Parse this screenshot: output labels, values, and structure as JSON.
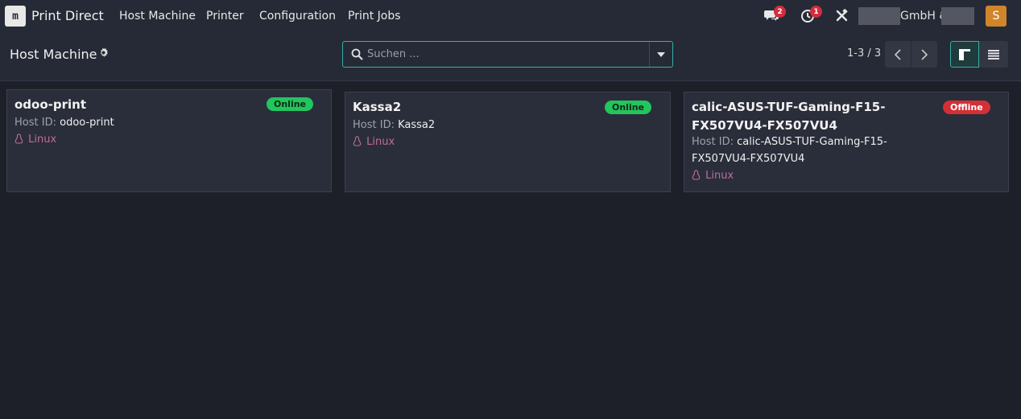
{
  "navbar": {
    "app_icon_text": "m",
    "app_name": "Print Direct",
    "menu": [
      "Host Machine",
      "Printer",
      "Configuration",
      "Print Jobs"
    ],
    "messages_count": "2",
    "activities_count": "1",
    "company_visible": "GmbH &",
    "avatar_letter": "S"
  },
  "control_panel": {
    "breadcrumb": "Host Machine",
    "search_placeholder": "Suchen ...",
    "pager": "1-3 / 3"
  },
  "cards": [
    {
      "name": "odoo-print",
      "host_label": "Host ID:",
      "host_id": "odoo-print",
      "os": "Linux",
      "status": "Online"
    },
    {
      "name": "Kassa2",
      "host_label": "Host ID:",
      "host_id": "Kassa2",
      "os": "Linux",
      "status": "Online"
    },
    {
      "name_line1": "calic-ASUS-TUF-Gaming-F15-",
      "name_line2": "FX507VU4-FX507VU4",
      "host_label": "Host ID:",
      "host_id_line1": "calic-ASUS-TUF-Gaming-F15-",
      "host_id_line2": "FX507VU4-FX507VU4",
      "os": "Linux",
      "status": "Offline"
    }
  ],
  "colors": {
    "accent": "#36b0a4",
    "online": "#22c55e",
    "offline": "#d32f36",
    "os_text": "#c06c9e",
    "avatar": "#d0852b"
  }
}
